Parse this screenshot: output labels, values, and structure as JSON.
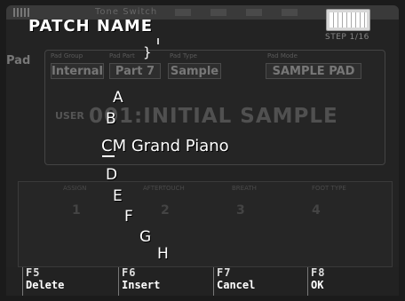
{
  "header": {
    "background_title": "Tone Switch",
    "dialog_title": "PATCH NAME",
    "step": "STEP  1/16"
  },
  "background_form": {
    "side_label": "Pad",
    "pad_group_label": "Pad Group",
    "pad_part_label": "Pad Part",
    "pad_type_label": "Pad Type",
    "pad_mode_label": "Pad Mode",
    "pad_group_value": "Internal",
    "pad_part_value": "Part 7",
    "pad_type_value": "Sample",
    "pad_mode_value": "SAMPLE PAD",
    "user_label": "USER",
    "patch_display": "001:INITIAL SAMPLE",
    "aftertouch_label": "AFTERTOUCH",
    "breath_label": "BREATH",
    "foot_type_label": "FOOT TYPE",
    "assign_label": "ASSIGN",
    "slot_1": "1",
    "slot_2": "2",
    "slot_3": "3",
    "slot_4": "4"
  },
  "character_list": {
    "above": [
      "A",
      "B"
    ],
    "selected_char": "C",
    "name_rest": "M Grand Piano",
    "below": [
      "D",
      "E",
      "F",
      "G",
      "H"
    ]
  },
  "brace_glyph": "}",
  "function_keys": [
    {
      "key": "F5",
      "label": "Delete"
    },
    {
      "key": "F6",
      "label": "Insert"
    },
    {
      "key": "F7",
      "label": "Cancel"
    },
    {
      "key": "F8",
      "label": "OK"
    }
  ]
}
